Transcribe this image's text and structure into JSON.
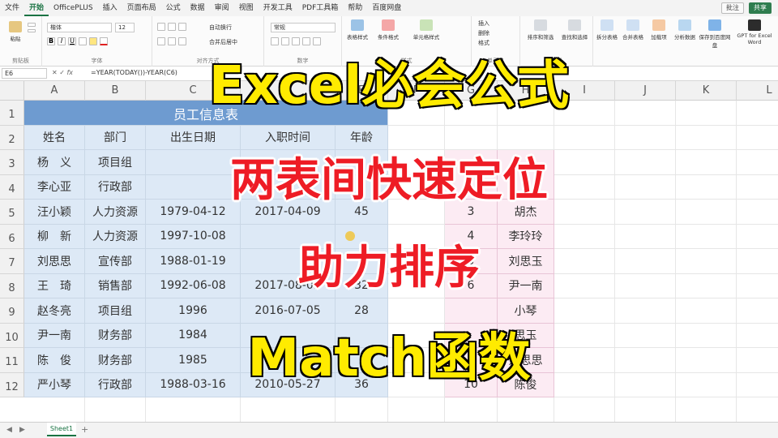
{
  "menubar": {
    "items": [
      "文件",
      "开始",
      "OfficePLUS",
      "插入",
      "页面布局",
      "公式",
      "数据",
      "审阅",
      "视图",
      "开发工具",
      "PDF工具箱",
      "帮助",
      "百度网盘"
    ],
    "active_index": 1,
    "share_label": "共享",
    "extra_label": "批注"
  },
  "ribbon": {
    "font_name": "楷体",
    "font_size": "12",
    "number_format": "常规",
    "groups": [
      {
        "label": "剪贴板"
      },
      {
        "label": "字体"
      },
      {
        "label": "对齐方式"
      },
      {
        "label": "数字"
      },
      {
        "label": "样式"
      },
      {
        "label": "单元格"
      },
      {
        "label": "编辑"
      }
    ],
    "buttons": [
      "粘贴",
      "自动换行",
      "合并后居中",
      "表格样式",
      "条件格式",
      "单元格样式",
      "插入",
      "删除",
      "格式",
      "排序和筛选",
      "查找和选择",
      "拆分表格",
      "合并表格",
      "加载项",
      "分析数据",
      "保存到百度网盘",
      "GPT for Excel Word"
    ]
  },
  "formulabar": {
    "cell_ref": "E6",
    "formula": "=YEAR(TODAY())-YEAR(C6)"
  },
  "columns": [
    "A",
    "B",
    "C",
    "D",
    "E",
    "F",
    "G",
    "H",
    "I",
    "J",
    "K",
    "L"
  ],
  "rows": [
    "1",
    "2",
    "3",
    "4",
    "5",
    "6",
    "7",
    "8",
    "9",
    "10",
    "11",
    "12"
  ],
  "table": {
    "title": "员工信息表",
    "headers": [
      "姓名",
      "部门",
      "出生日期",
      "入职时间",
      "年龄"
    ],
    "records": [
      [
        "杨　义",
        "项目组",
        "",
        "",
        ""
      ],
      [
        "李心亚",
        "行政部",
        "",
        "",
        "3"
      ],
      [
        "汪小颖",
        "人力资源",
        "1979-04-12",
        "2017-04-09",
        "45"
      ],
      [
        "柳　新",
        "人力资源",
        "1997-10-08",
        "",
        ""
      ],
      [
        "刘思思",
        "宣传部",
        "1988-01-19",
        "",
        "3"
      ],
      [
        "王　琦",
        "销售部",
        "1992-06-08",
        "2017-08-09",
        "32"
      ],
      [
        "赵冬亮",
        "项目组",
        "1996",
        "2016-07-05",
        "28"
      ],
      [
        "尹一南",
        "财务部",
        "1984",
        "",
        ""
      ],
      [
        "陈　俊",
        "财务部",
        "1985",
        "",
        ""
      ],
      [
        "严小琴",
        "行政部",
        "1988-03-16",
        "2010-05-27",
        "36"
      ]
    ]
  },
  "side_table": {
    "records": [
      [
        "3",
        "胡杰"
      ],
      [
        "4",
        "李玲玲"
      ],
      [
        "5",
        "刘思玉"
      ],
      [
        "6",
        "尹一南"
      ],
      [
        "",
        "小琴"
      ],
      [
        "",
        "思玉"
      ],
      [
        "",
        "刘思思"
      ],
      [
        "10",
        "陈俊"
      ]
    ]
  },
  "overlay": {
    "line1": "Excel必会公式",
    "line2": "两表间快速定位",
    "line3": "助力排序",
    "line4": "Match函数"
  },
  "tabs": {
    "sheet_name": "Sheet1",
    "add_symbol": "+"
  }
}
